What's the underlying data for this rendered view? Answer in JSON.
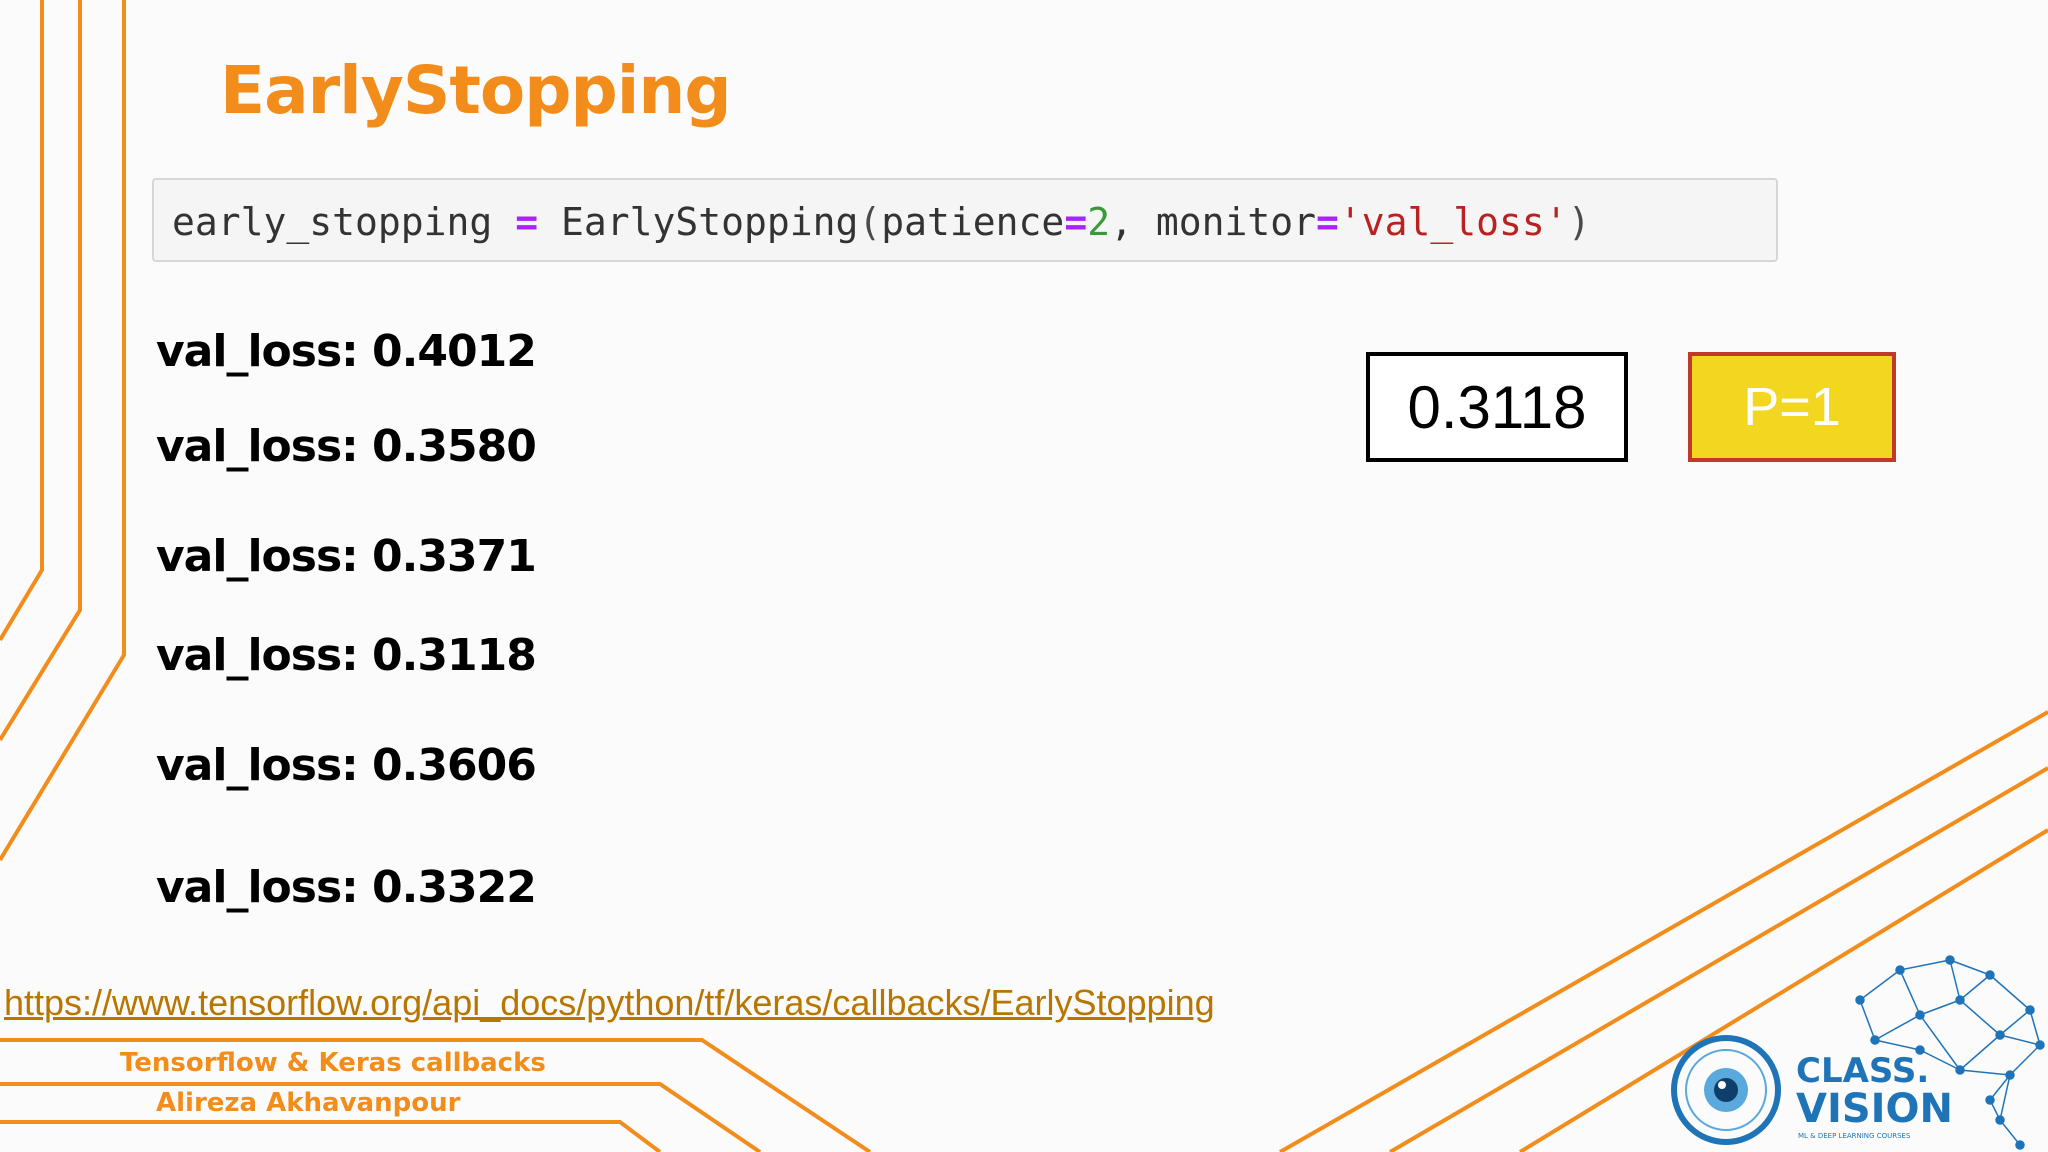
{
  "title": "EarlyStopping",
  "code": {
    "var": "early_stopping",
    "op_assign": "=",
    "func": "EarlyStopping",
    "open_paren": "(",
    "arg1_name": "patience",
    "op_eq1": "=",
    "arg1_value": "2",
    "comma": ", ",
    "arg2_name": "monitor",
    "op_eq2": "=",
    "arg2_value": "'val_loss'",
    "close_paren": ")"
  },
  "val_losses": [
    "val_loss: 0.4012",
    "val_loss: 0.3580",
    "val_loss: 0.3371",
    "val_loss: 0.3118",
    "val_loss: 0.3606",
    "val_loss: 0.3322"
  ],
  "best_value": "0.3118",
  "patience_counter": "P=1",
  "reference_link": "https://www.tensorflow.org/api_docs/python/tf/keras/callbacks/EarlyStopping",
  "footer": {
    "course": "Tensorflow & Keras callbacks",
    "author": "Alireza Akhavanpour"
  },
  "logo": {
    "brand": "CLASS.VISION",
    "tagline": "ML & DEEP LEARNING COURSES"
  },
  "colors": {
    "accent": "#f28c1b",
    "patience_fill": "#f3d61f",
    "patience_border": "#c0392b",
    "logo_blue": "#1f74b8"
  }
}
